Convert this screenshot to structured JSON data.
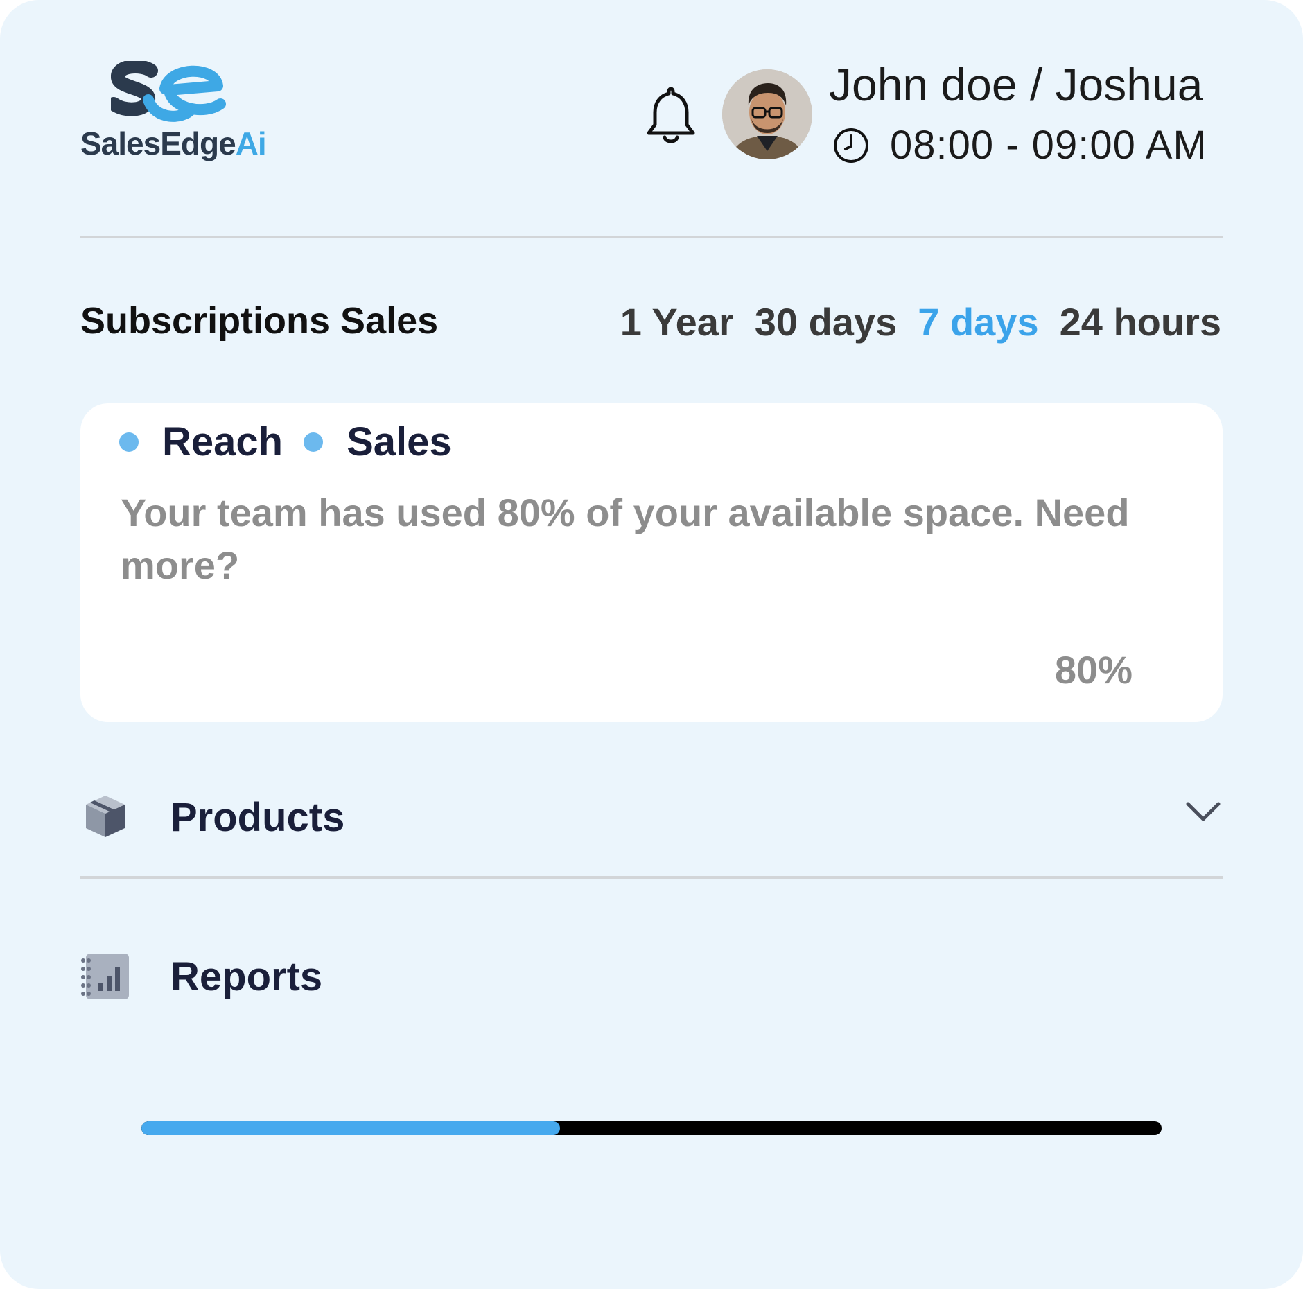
{
  "brand": {
    "name": "SalesEdge",
    "suffix": "Ai"
  },
  "header": {
    "user_name": "John doe / Joshua",
    "time_range": "08:00 - 09:00 AM"
  },
  "section": {
    "title": "Subscriptions Sales",
    "periods": [
      {
        "label": "1 Year",
        "active": false
      },
      {
        "label": "30 days",
        "active": false
      },
      {
        "label": "7 days",
        "active": true
      },
      {
        "label": "24 hours",
        "active": false
      }
    ]
  },
  "panel": {
    "legend": [
      "Reach",
      "Sales"
    ],
    "message": "Your team has used 80% of your available space. Need more?",
    "percent_label": "80%"
  },
  "menu": {
    "products": {
      "label": "Products",
      "icon": "box-icon"
    },
    "reports": {
      "label": "Reports",
      "icon": "report-chart-icon"
    }
  },
  "progress": {
    "value": 0.41
  },
  "colors": {
    "accent": "#3ba3ea",
    "background": "#ebf5fc",
    "legend_dot": "#6cb9ee",
    "heading": "#1a1f3a"
  }
}
